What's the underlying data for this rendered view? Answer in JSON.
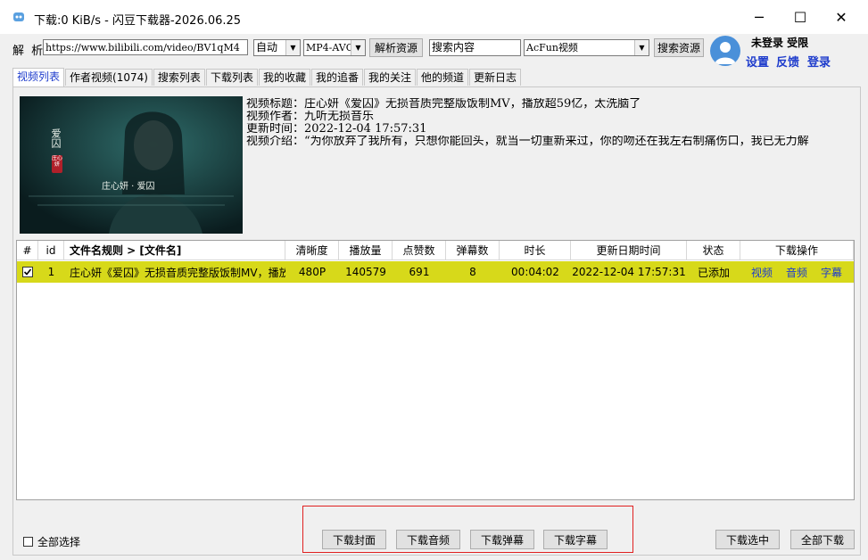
{
  "window": {
    "title": "下载:0 KiB/s - 闪豆下载器-2026.06.25",
    "minimize": "─",
    "maximize": "☐",
    "close": "✕"
  },
  "toolbar": {
    "parse_label": "解 析:",
    "url_value": "https://www.bilibili.com/video/BV1qM4",
    "mode_select": "自动",
    "format_select": "MP4-AVC",
    "parse_button": "解析资源",
    "search_placeholder": "搜索内容",
    "site_select": "AcFun视频",
    "search_button": "搜索资源"
  },
  "user": {
    "status": "未登录  受限",
    "settings": "设置",
    "feedback": "反馈",
    "login": "登录"
  },
  "tabs": [
    "视频列表",
    "作者视频(1074)",
    "搜索列表",
    "下载列表",
    "我的收藏",
    "我的追番",
    "我的关注",
    "他的频道",
    "更新日志"
  ],
  "video_info": {
    "title_line": "视频标题：庄心妍《爱囚》无损音质完整版饭制MV，播放超59亿，太洗脑了",
    "author_line": "视频作者：九听无损音乐",
    "update_line": "更新时间：2022-12-04 17:57:31",
    "intro_line": "视频介绍：“为你放弃了我所有，只想你能回头，就当一切重新来过，你的吻还在我左右制痛伤口，我已无力解",
    "cover_title": "爱囚",
    "cover_seal": "庄心妍",
    "cover_caption": "庄心妍 · 爱囚"
  },
  "table": {
    "headers": [
      "#",
      "id",
      "文件名规则  >   [文件名]",
      "清晰度",
      "播放量",
      "点赞数",
      "弹幕数",
      "时长",
      "更新日期时间",
      "状态",
      "下载操作"
    ],
    "rows": [
      {
        "index": "1",
        "filename": "庄心妍《爱囚》无损音质完整版饭制MV，播放",
        "quality": "480P",
        "plays": "140579",
        "likes": "691",
        "danmaku": "8",
        "duration": "00:04:02",
        "updated": "2022-12-04 17:57:31",
        "status": "已添加",
        "op_video": "视频",
        "op_audio": "音频",
        "op_subtitle": "字幕"
      }
    ]
  },
  "bottom": {
    "select_all": "全部选择",
    "download_cover": "下载封面",
    "download_audio": "下载音频",
    "download_danmaku": "下载弹幕",
    "download_subtitle": "下载字幕",
    "download_selected": "下载选中",
    "download_all": "全部下载"
  },
  "colors": {
    "accent_blue": "#1e3ccc",
    "row_highlight": "#d7d91a",
    "highlight_box": "#e02020"
  }
}
